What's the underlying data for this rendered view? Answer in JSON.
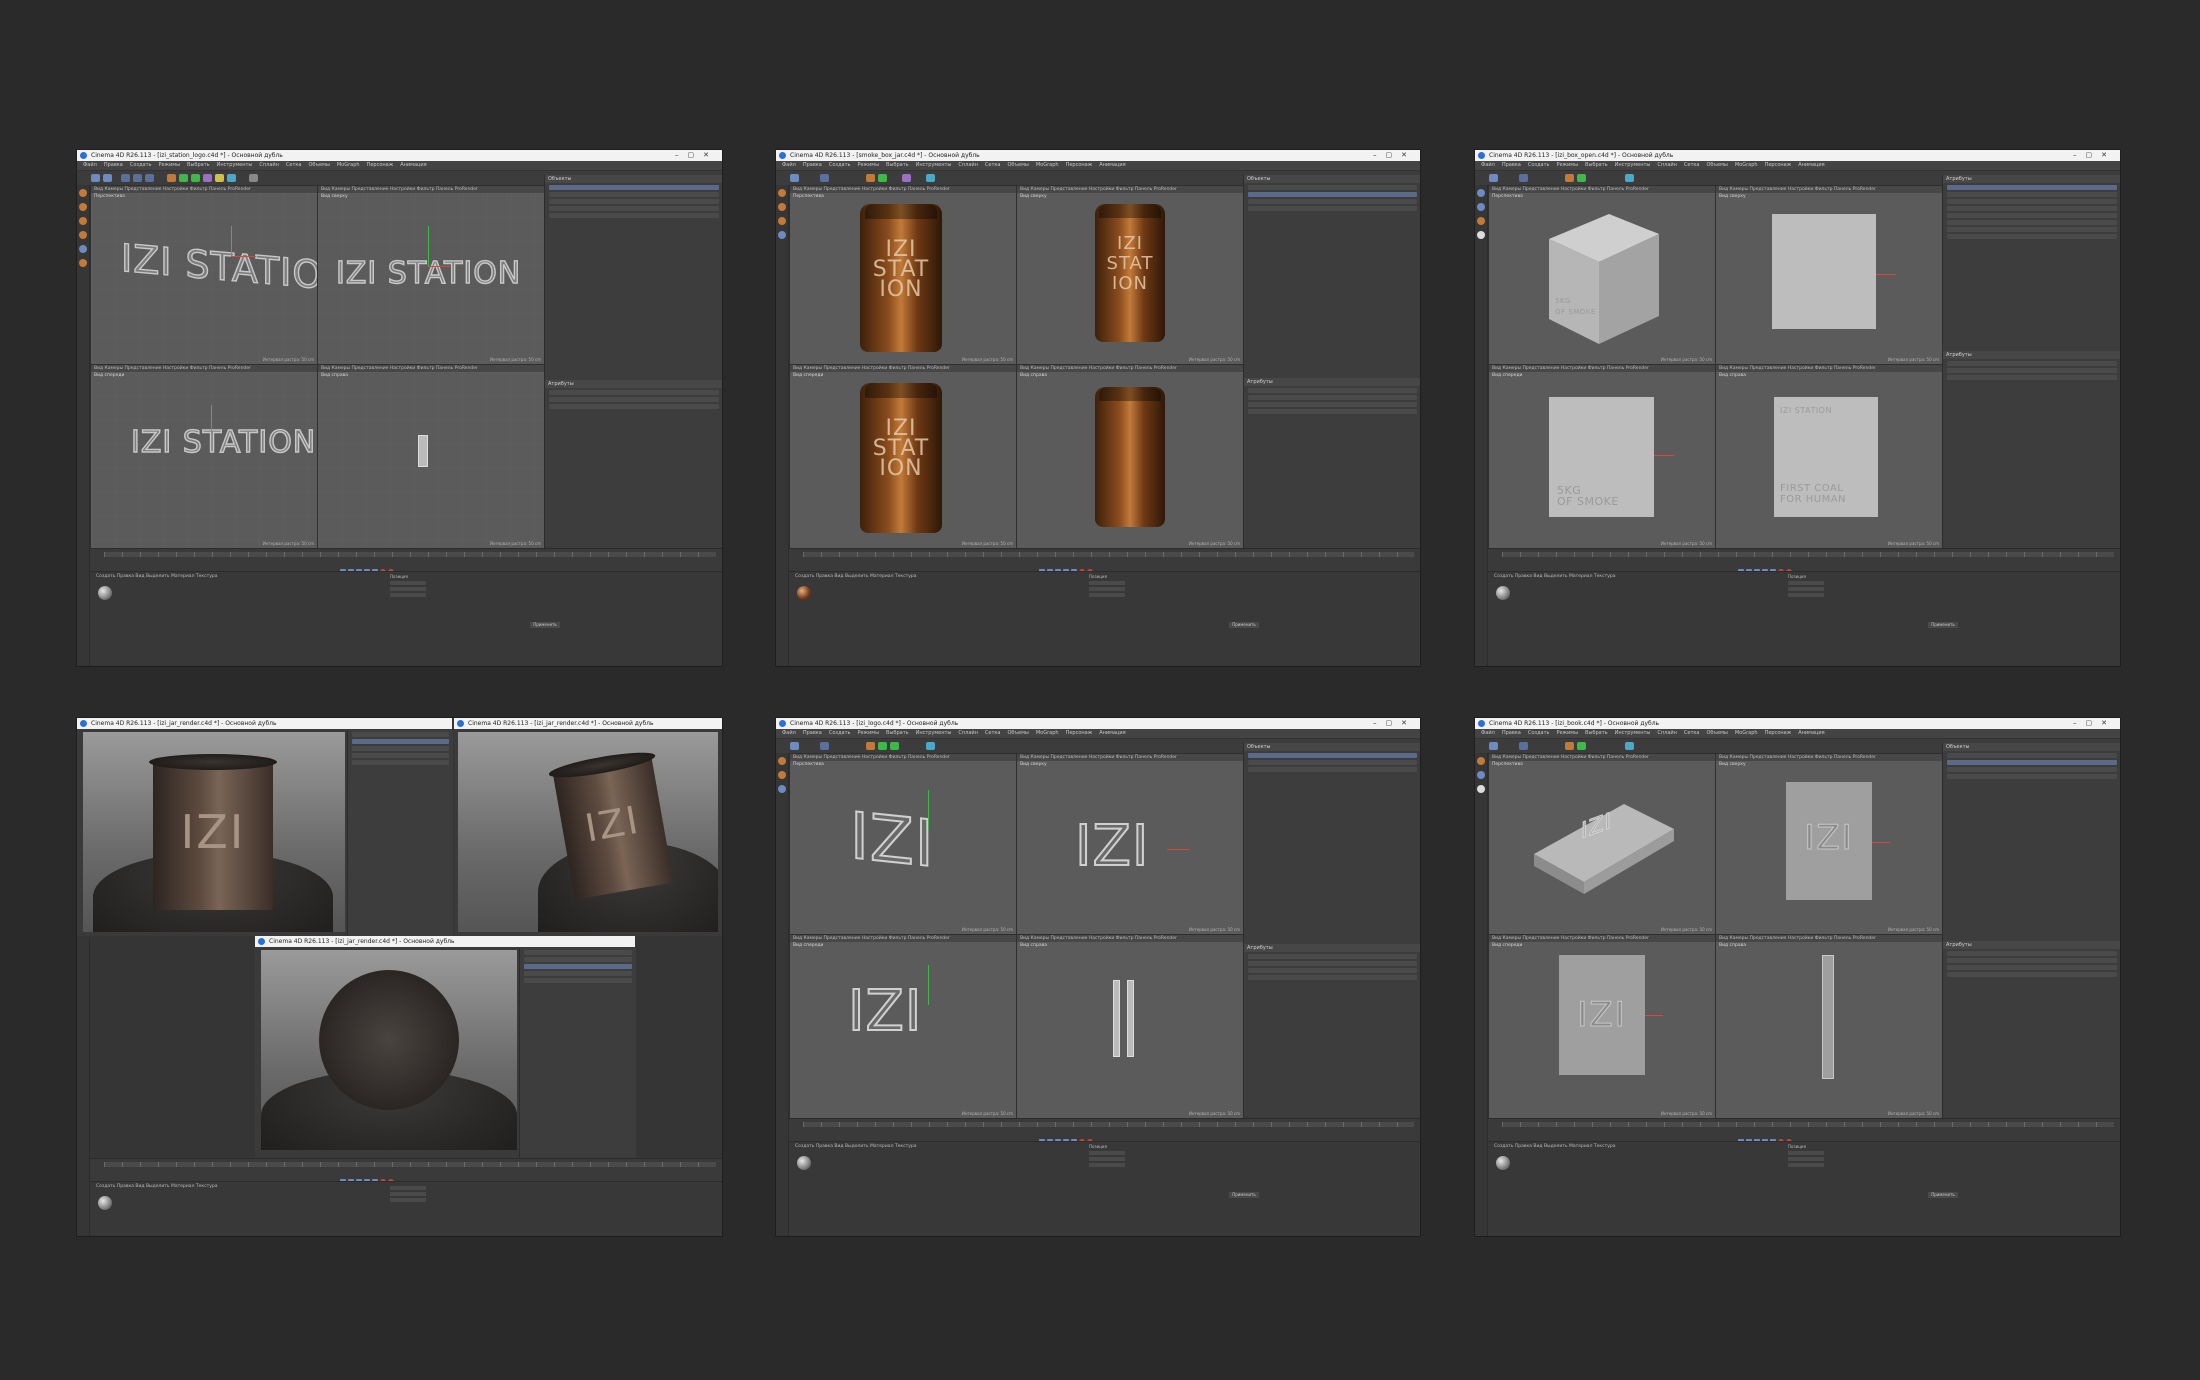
{
  "panels": [
    {
      "title": "Cinema 4D R26.113 - [izi_station_logo.c4d *] - Основной дубль",
      "vp_names": [
        "Перспектива",
        "Вид сверху",
        "Вид спереди",
        "Вид справа"
      ],
      "logo_text": "IZI STATION"
    },
    {
      "title": "Cinema 4D R26.113 - [smoke_box_jar.c4d *] - Основной дубль",
      "vp_names": [
        "Перспектива",
        "Вид сверху",
        "Вид спереди",
        "Вид справа"
      ],
      "jar_text": "IZI\nSTAT\nION"
    },
    {
      "title": "Cinema 4D R26.113 - [izi_box_open.c4d *] - Основной дубль",
      "vp_names": [
        "Перспектива",
        "Вид сверху",
        "Вид спереди",
        "Вид справа"
      ],
      "box_front": "5KG\nOF SMOKE",
      "box_side": "FIRST COAL\nFOR HUMAN",
      "box_logo": "IZI STATION"
    },
    {
      "title": "Cinema 4D R26.113 - [izi_jar_render.c4d *] - Основной дубль",
      "can_label": "IZI"
    },
    {
      "title": "Cinema 4D R26.113 - [izi_logo.c4d *] - Основной дубль",
      "vp_names": [
        "Перспектива",
        "Вид сверху",
        "Вид спереди",
        "Вид справа"
      ],
      "logo_text": "IZI"
    },
    {
      "title": "Cinema 4D R26.113 - [izi_book.c4d *] - Основной дубль",
      "vp_names": [
        "Перспектива",
        "Вид сверху",
        "Вид спереди",
        "Вид справа"
      ],
      "logo_text": "IZI"
    }
  ],
  "menu": [
    "Файл",
    "Правка",
    "Создать",
    "Режимы",
    "Выбрать",
    "Инструменты",
    "Сплайн",
    "Сетка",
    "Объемы",
    "MoGraph",
    "Персонаж",
    "Анимация",
    "Симуляция",
    "Трекер",
    "Рендер",
    "Расширения",
    "Окно",
    "Справка"
  ],
  "objects_header": "Объекты",
  "attributes_header": "Атрибуты",
  "vp_menu": "Вид  Камеры  Представление  Настройки  Фильтр  Панель  ProRender",
  "scale_label": "Интервал растра: 50 cm",
  "material_menu": "Создать  Правка  Вид  Выделить  Материал  Текстура",
  "coords_headers": [
    "Позиция",
    "Размер",
    "Вращение"
  ],
  "apply_label": "Применить",
  "colors": {
    "page_bg": "#2a2a2a",
    "ui_bg": "#3a3a3a",
    "viewport": "#5b5b5b",
    "axis_y": "#3fb84a",
    "axis_x": "#d8463f",
    "accent_blue": "#6d8bc0"
  }
}
